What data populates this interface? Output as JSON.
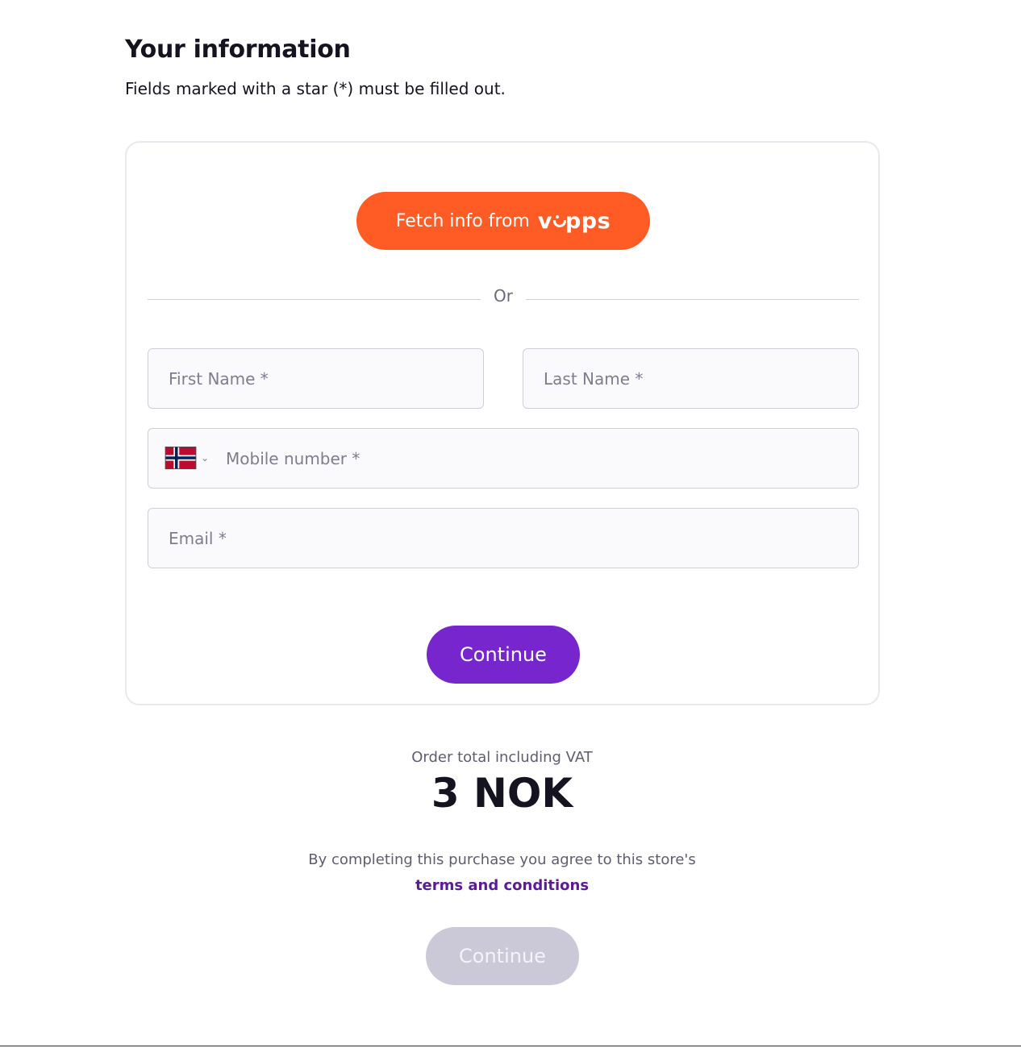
{
  "header": {
    "title": "Your information",
    "subtitle": "Fields marked with a star (*) must be filled out."
  },
  "vipps": {
    "button_label": "Fetch info from",
    "logo_text_before": "v",
    "logo_text_after": "pps",
    "brand_color": "#ff5b24"
  },
  "divider": {
    "text": "Or"
  },
  "form": {
    "first_name": {
      "value": "",
      "placeholder": "First Name *"
    },
    "last_name": {
      "value": "",
      "placeholder": "Last Name *"
    },
    "mobile": {
      "country_flag": "norway-flag-icon",
      "value": "",
      "placeholder": "Mobile number *"
    },
    "email": {
      "value": "",
      "placeholder": "Email *"
    },
    "continue_label": "Continue",
    "continue_color": "#7626cc"
  },
  "order": {
    "total_label": "Order total including VAT",
    "total_value": "3 NOK"
  },
  "terms": {
    "text": "By completing this purchase you agree to this store's",
    "link_text": "terms and conditions",
    "link_color": "#5c1a99"
  },
  "footer": {
    "continue_label": "Continue",
    "continue_disabled_color": "#cbc8d8"
  }
}
